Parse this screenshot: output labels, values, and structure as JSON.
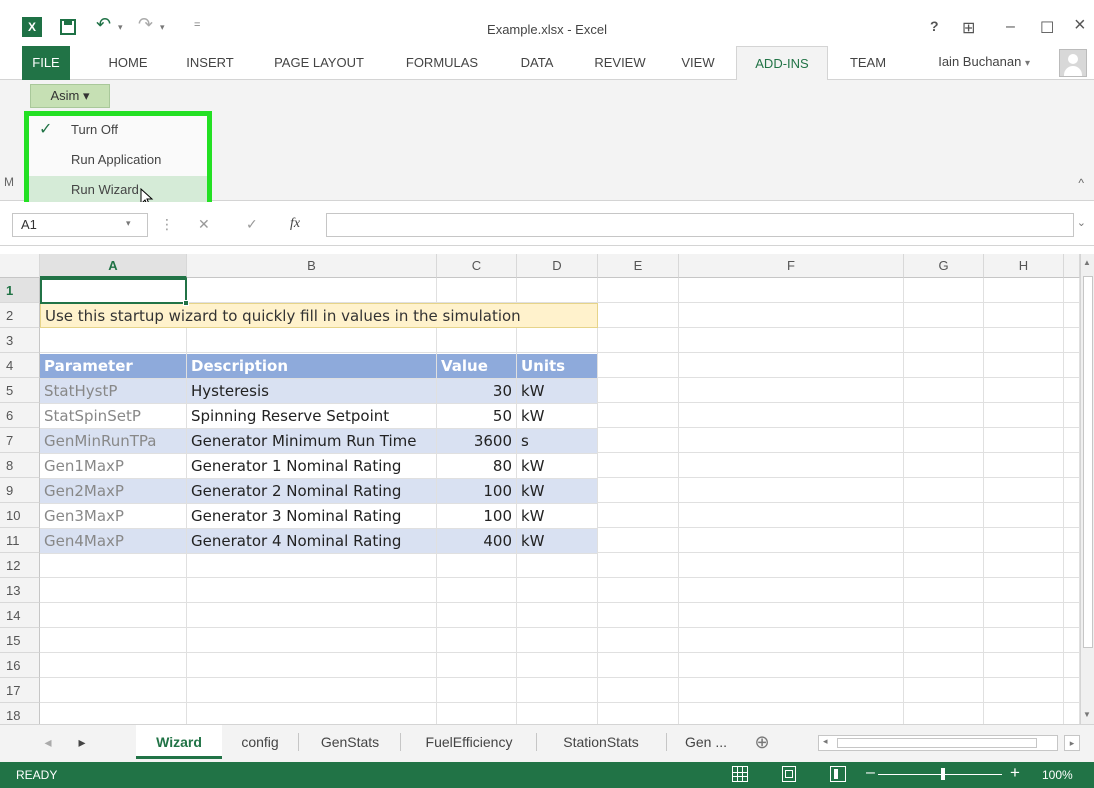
{
  "window": {
    "title": "Example.xlsx - Excel",
    "buttons": {
      "help": "?",
      "ribbon_display": "⊞",
      "minimize": "–",
      "maximize": "☐",
      "close": "×"
    }
  },
  "quick_access": {
    "undo": "↶",
    "redo": "↷",
    "dropdown": "▾",
    "customize": "="
  },
  "ribbon_tabs": [
    "FILE",
    "HOME",
    "INSERT",
    "PAGE LAYOUT",
    "FORMULAS",
    "DATA",
    "REVIEW",
    "VIEW",
    "ADD-INS",
    "TEAM"
  ],
  "active_tab": "ADD-INS",
  "user": {
    "name": "Iain Buchanan",
    "dropdown": "▾"
  },
  "ribbon": {
    "asim_button": "Asim ▾",
    "group_label_fragment": "M",
    "collapse": "^"
  },
  "asim_menu": {
    "items": [
      {
        "label": "Turn Off",
        "checked": true
      },
      {
        "label": "Run Application",
        "checked": false
      },
      {
        "label": "Run Wizard",
        "checked": false,
        "hovered": true
      }
    ],
    "check_glyph": "✓"
  },
  "formula_bar": {
    "name_box": "A1",
    "name_box_dd": "▾",
    "sep": "⋮",
    "cancel": "✕",
    "enter": "✓",
    "fx": "fx",
    "value": "",
    "expand": "⌄"
  },
  "columns": [
    "A",
    "B",
    "C",
    "D",
    "E",
    "F",
    "G",
    "H"
  ],
  "selected_column": "A",
  "rows": [
    "1",
    "2",
    "3",
    "4",
    "5",
    "6",
    "7",
    "8",
    "9",
    "10",
    "11",
    "12",
    "13",
    "14",
    "15",
    "16",
    "17",
    "18"
  ],
  "selected_row": "1",
  "sheet": {
    "banner": "Use this startup wizard to quickly fill in values in the simulation",
    "table_header": {
      "parameter": "Parameter",
      "description": "Description",
      "value": "Value",
      "units": "Units"
    },
    "table_rows": [
      {
        "parameter": "StatHystP",
        "description": "Hysteresis",
        "value": "30",
        "units": "kW"
      },
      {
        "parameter": "StatSpinSetP",
        "description": "Spinning Reserve Setpoint",
        "value": "50",
        "units": "kW"
      },
      {
        "parameter": "GenMinRunTPa",
        "description": "Generator Minimum Run Time",
        "value": "3600",
        "units": "s"
      },
      {
        "parameter": "Gen1MaxP",
        "description": "Generator 1 Nominal Rating",
        "value": "80",
        "units": "kW"
      },
      {
        "parameter": "Gen2MaxP",
        "description": "Generator 2 Nominal Rating",
        "value": "100",
        "units": "kW"
      },
      {
        "parameter": "Gen3MaxP",
        "description": "Generator 3 Nominal Rating",
        "value": "100",
        "units": "kW"
      },
      {
        "parameter": "Gen4MaxP",
        "description": "Generator 4 Nominal Rating",
        "value": "400",
        "units": "kW"
      }
    ]
  },
  "sheet_tabs": {
    "nav_prev": "◂",
    "nav_next": "▸",
    "tabs": [
      "Wizard",
      "config",
      "GenStats",
      "FuelEfficiency",
      "StationStats",
      "Gen ..."
    ],
    "active": "Wizard",
    "add": "⊕"
  },
  "status": {
    "ready": "READY",
    "zoom": "100%",
    "zoom_out": "–",
    "zoom_in": "+"
  }
}
